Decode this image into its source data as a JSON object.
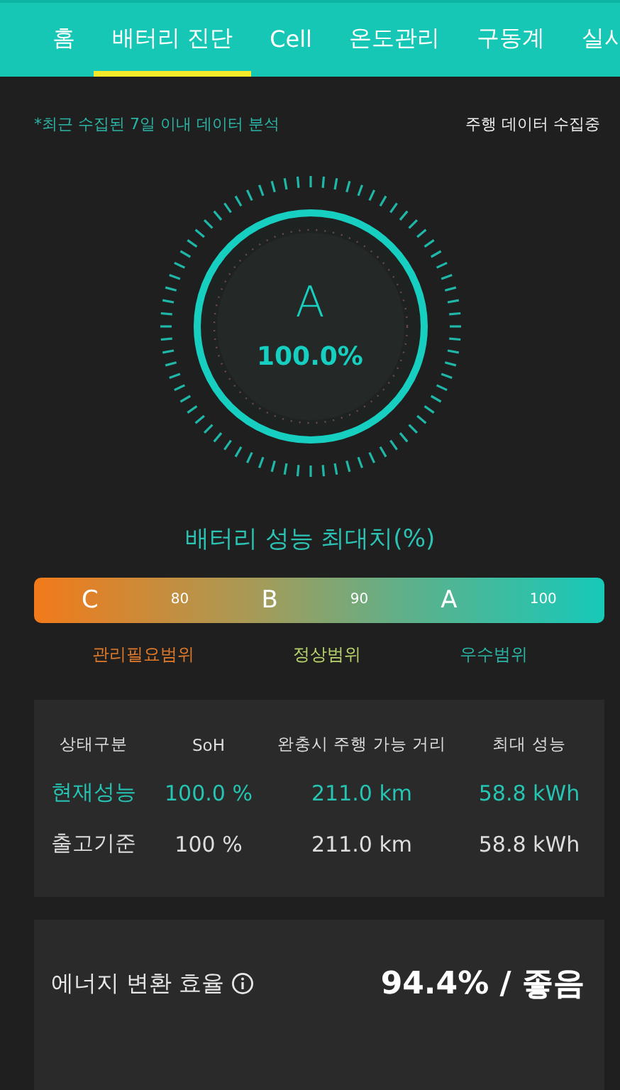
{
  "tabs": [
    {
      "label": "홈",
      "selected": false
    },
    {
      "label": "배터리 진단",
      "selected": true
    },
    {
      "label": "Cell",
      "selected": false
    },
    {
      "label": "온도관리",
      "selected": false
    },
    {
      "label": "구동계",
      "selected": false
    },
    {
      "label": "실시",
      "selected": false
    }
  ],
  "note": "*최근 수집된 7일 이내 데이터 분석",
  "status": "주행 데이터 수집중",
  "gauge": {
    "grade": "A",
    "value": "100.0%",
    "level": 1.0
  },
  "gauge_title": "배터리 성능 최대치(%)",
  "scale": {
    "marks": [
      {
        "kind": "grade",
        "text": "C"
      },
      {
        "kind": "tick",
        "text": "80"
      },
      {
        "kind": "grade",
        "text": "B"
      },
      {
        "kind": "tick",
        "text": "90"
      },
      {
        "kind": "grade",
        "text": "A"
      },
      {
        "kind": "tick",
        "text": "100"
      }
    ],
    "ranges": [
      {
        "label": "관리필요범위",
        "color": "#e07a2a"
      },
      {
        "label": "정상범위",
        "color": "#b8d46a"
      },
      {
        "label": "우수범위",
        "color": "#2bb5a6"
      }
    ]
  },
  "table": {
    "columns": [
      "상태구분",
      "SoH",
      "완충시 주행 가능 거리",
      "최대 성능"
    ],
    "rows": [
      {
        "cells": [
          "현재성능",
          "100.0 %",
          "211.0 km",
          "58.8 kWh"
        ],
        "highlighted": true
      },
      {
        "cells": [
          "출고기준",
          "100 %",
          "211.0 km",
          "58.8 kWh"
        ],
        "highlighted": false
      }
    ]
  },
  "efficiency": {
    "label": "에너지 변환 효율",
    "value": "94.4% / 좋음"
  }
}
